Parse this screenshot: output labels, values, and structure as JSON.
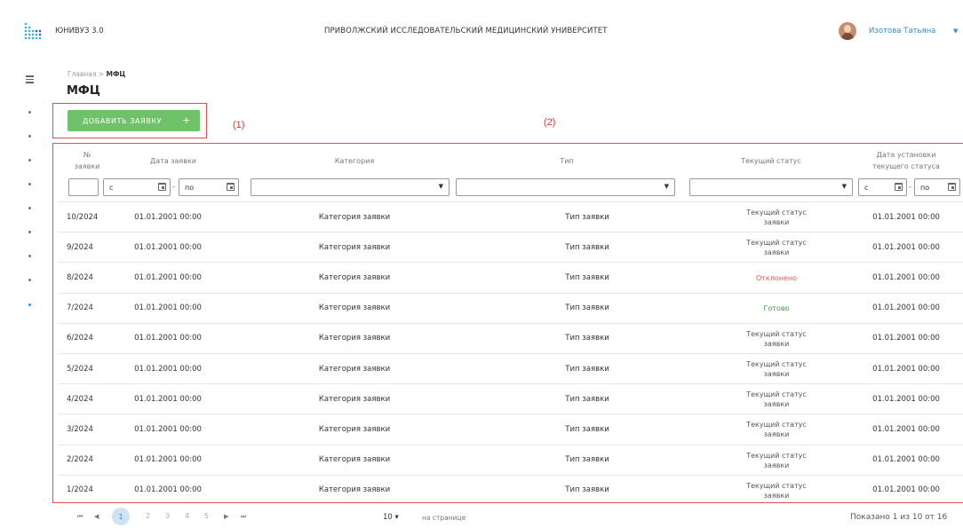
{
  "header": {
    "app_name": "ЮНИВУЗ 3.0",
    "university": "ПРИВОЛЖСКИЙ ИССЛЕДОВАТЕЛЬСКИЙ МЕДИЦИНСКИЙ УНИВЕРСИТЕТ",
    "user_name": "Изотова Татьяна",
    "user_caret": "▼",
    "logo_icon": "dots-grid-logo-icon",
    "avatar_icon": "user-avatar"
  },
  "breadcrumb": {
    "home": "Главная",
    "separator": ">",
    "current": "МФЦ"
  },
  "page_title": "МФЦ",
  "add_button": {
    "label": "ДОБАВИТЬ ЗАЯВКУ",
    "icon": "+"
  },
  "annotations": {
    "label1": "(1)",
    "label2": "(2)"
  },
  "table": {
    "headers": {
      "num_line1": "№",
      "num_line2": "заявки",
      "date": "Дата заявки",
      "category": "Категория",
      "type": "Тип",
      "status": "Текущий статус",
      "status_date_line1": "Дата установки",
      "status_date_line2": "текущего статуса"
    },
    "filters": {
      "date_from": "с",
      "date_to": "по",
      "dash": "-",
      "status_date_from": "с",
      "status_date_to": "по",
      "select_caret": "▼"
    },
    "rows": [
      {
        "num": "10/2024",
        "date": "01.01.2001 00:00",
        "category": "Категория заявки",
        "type": "Тип заявки",
        "status": "Текущий статус заявки",
        "status_kind": "default",
        "status_date": "01.01.2001 00:00"
      },
      {
        "num": "9/2024",
        "date": "01.01.2001 00:00",
        "category": "Категория заявки",
        "type": "Тип заявки",
        "status": "Текущий статус заявки",
        "status_kind": "default",
        "status_date": "01.01.2001 00:00"
      },
      {
        "num": "8/2024",
        "date": "01.01.2001 00:00",
        "category": "Категория заявки",
        "type": "Тип заявки",
        "status": "Отклонено",
        "status_kind": "rejected",
        "status_date": "01.01.2001 00:00"
      },
      {
        "num": "7/2024",
        "date": "01.01.2001 00:00",
        "category": "Категория заявки",
        "type": "Тип заявки",
        "status": "Готово",
        "status_kind": "done",
        "status_date": "01.01.2001 00:00"
      },
      {
        "num": "6/2024",
        "date": "01.01.2001 00:00",
        "category": "Категория заявки",
        "type": "Тип заявки",
        "status": "Текущий статус заявки",
        "status_kind": "default",
        "status_date": "01.01.2001 00:00"
      },
      {
        "num": "5/2024",
        "date": "01.01.2001 00:00",
        "category": "Категория заявки",
        "type": "Тип заявки",
        "status": "Текущий статус заявки",
        "status_kind": "default",
        "status_date": "01.01.2001 00:00"
      },
      {
        "num": "4/2024",
        "date": "01.01.2001 00:00",
        "category": "Категория заявки",
        "type": "Тип заявки",
        "status": "Текущий статус заявки",
        "status_kind": "default",
        "status_date": "01.01.2001 00:00"
      },
      {
        "num": "3/2024",
        "date": "01.01.2001 00:00",
        "category": "Категория заявки",
        "type": "Тип заявки",
        "status": "Текущий статус заявки",
        "status_kind": "default",
        "status_date": "01.01.2001 00:00"
      },
      {
        "num": "2/2024",
        "date": "01.01.2001 00:00",
        "category": "Категория заявки",
        "type": "Тип заявки",
        "status": "Текущий статус заявки",
        "status_kind": "default",
        "status_date": "01.01.2001 00:00"
      },
      {
        "num": "1/2024",
        "date": "01.01.2001 00:00",
        "category": "Категория заявки",
        "type": "Тип заявки",
        "status": "Текущий статус заявки",
        "status_kind": "default",
        "status_date": "01.01.2001 00:00"
      }
    ]
  },
  "pagination": {
    "first": "⏮",
    "prev": "◀",
    "pages": [
      "1",
      "2",
      "3",
      "4",
      "5"
    ],
    "next": "▶",
    "last": "⏭",
    "per_page": "10 ▾",
    "per_page_label": "на странице",
    "shown": "Показано 1 из 10 от 16"
  },
  "colors": {
    "accent": "#2e8fd1",
    "button_green": "#6fc16a",
    "annotation_red": "#e05050",
    "status_rejected": "#e05a4f",
    "status_done": "#3f9a45"
  }
}
